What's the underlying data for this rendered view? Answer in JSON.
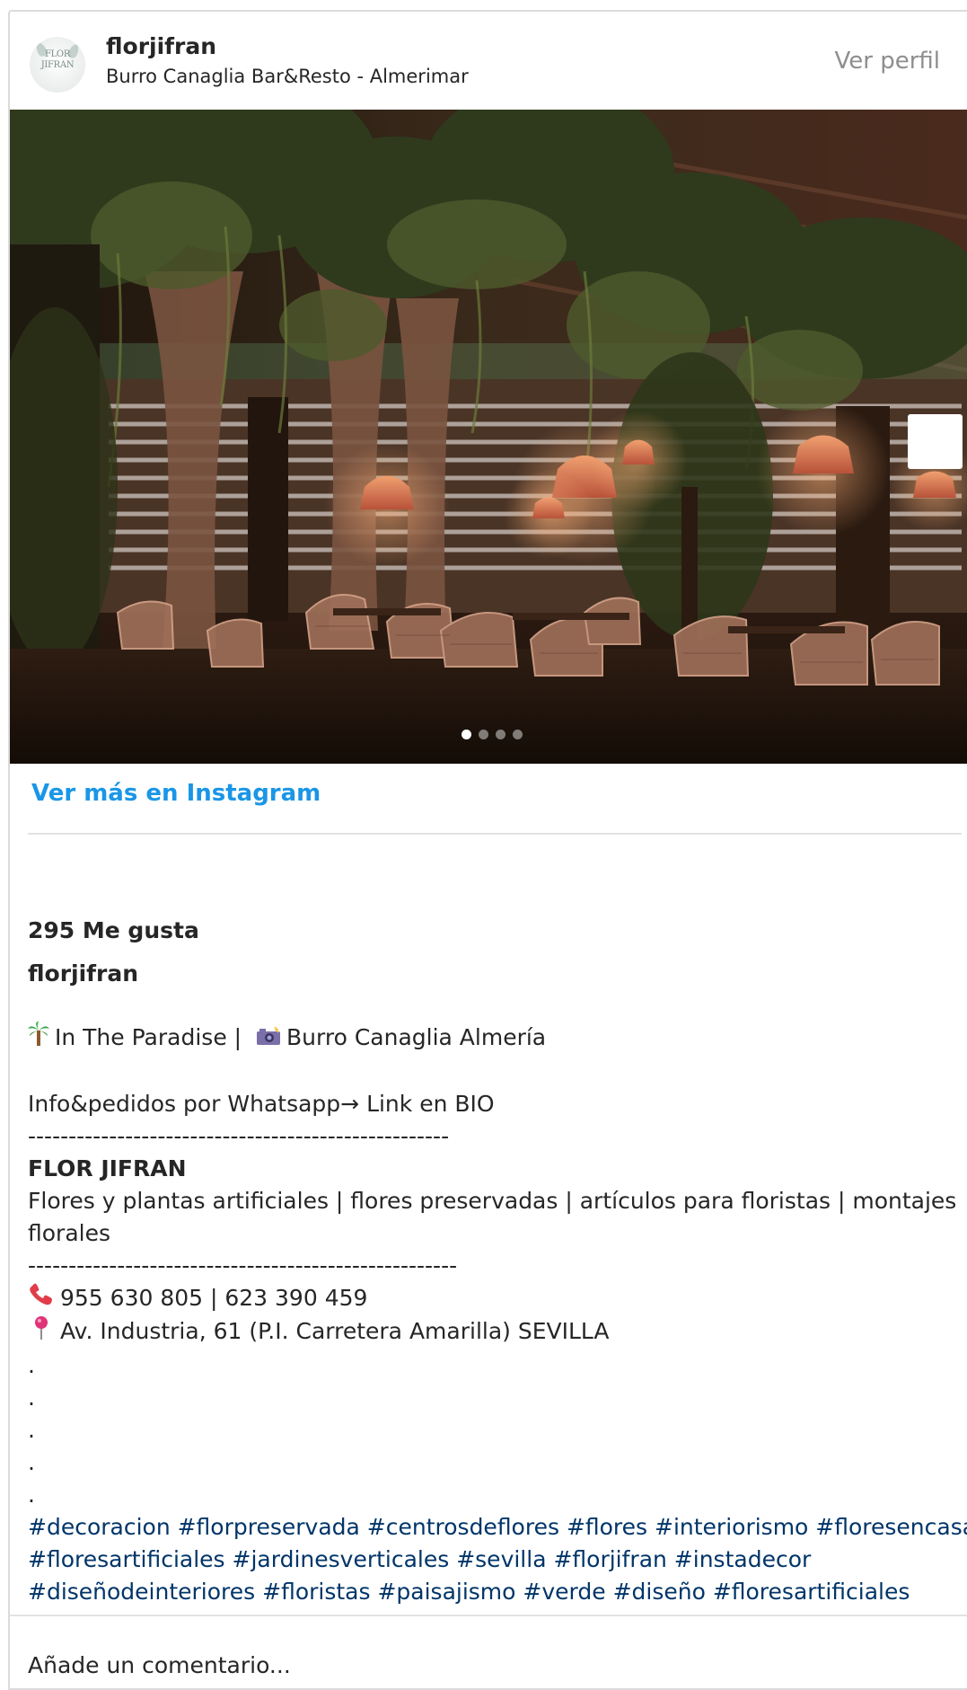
{
  "header": {
    "avatar_logo_text": "FLOR JIFRAN",
    "username": "florjifran",
    "location": "Burro Canaglia Bar&Resto - Almerimar",
    "view_profile": "Ver perfil"
  },
  "media": {
    "slide_count": 4,
    "active_slide": 1
  },
  "more_link": "Ver más en Instagram",
  "likes": "295 Me gusta",
  "caption": {
    "username": "florjifran",
    "line_paradise": "In The Paradise |",
    "line_paradise_place": "Burro Canaglia Almería",
    "line_info": "Info&pedidos por Whatsapp→ Link en BIO",
    "separator_1": "----------------------------------------------------",
    "brand": "FLOR JIFRAN",
    "description": "Flores y plantas artificiales | flores preservadas | artículos para floristas | montajes florales",
    "separator_2": "-----------------------------------------------------",
    "phone": "955 630 805 | 623 390 459",
    "address": "Av. Industria, 61 (P.I. Carretera Amarilla) SEVILLA",
    "dots": [
      ".",
      ".",
      ".",
      ".",
      "."
    ],
    "hashtags_line1": "#decoracion #florpreservada #centrosdeflores #flores #interiorismo #floresencasa",
    "hashtags_line2": "#floresartificiales #jardinesverticales #sevilla #florjifran #instadecor",
    "hashtags_line3": "#diseñodeinteriores #floristas #paisajismo #verde #diseño #floresartificiales"
  },
  "comment_placeholder": "Añade un comentario...",
  "icons": {
    "palm": "palm-tree-icon",
    "camera": "camera-flash-icon",
    "phone": "telephone-receiver-icon",
    "pin": "round-pushpin-icon"
  },
  "colors": {
    "link_blue": "#1a96e6",
    "hashtag": "#003569",
    "muted": "#8e8e8e"
  }
}
